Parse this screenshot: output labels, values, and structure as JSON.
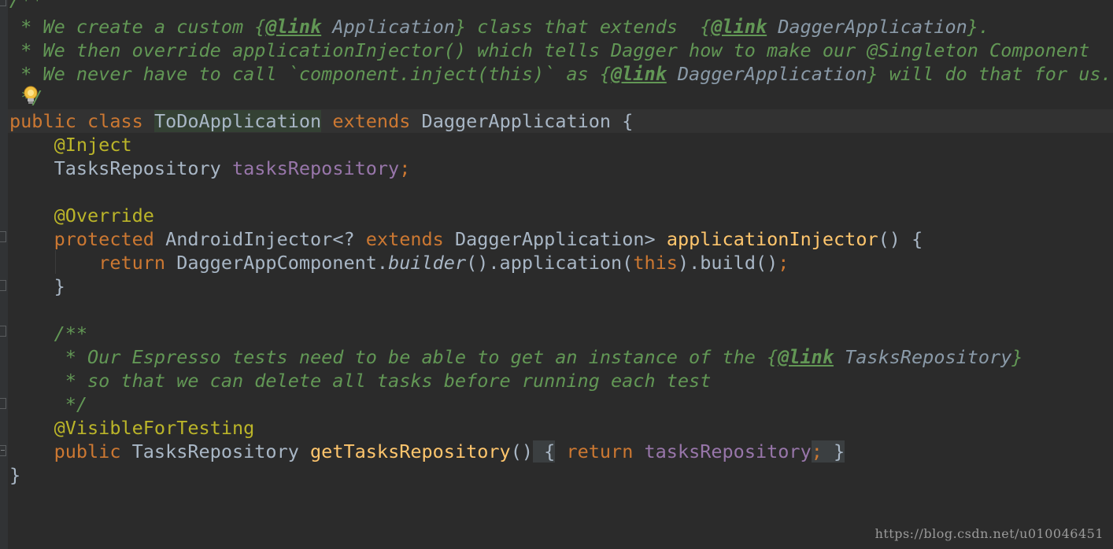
{
  "javadoc_top": {
    "open": "/**",
    "line1": {
      "star": " * We create a custom {",
      "tag1": "@link",
      "ref1": " Application",
      "mid": "} class that extends  {",
      "tag2": "@link",
      "ref2": " DaggerApplication",
      "end": "}."
    },
    "line2": " * We then override applicationInjector() which tells Dagger how to make our @Singleton Component",
    "line3": {
      "start": " * We never have to call `component.inject(this)` as {",
      "tag": "@link",
      "ref": " DaggerApplication",
      "end": "} will do that for us."
    },
    "close": " */"
  },
  "class_decl": {
    "kw_public": "public",
    "kw_class": "class",
    "name": "ToDoApplication",
    "kw_extends": "extends",
    "parent": "DaggerApplication",
    "brace": " {"
  },
  "field": {
    "annotation": "@Inject",
    "type": "TasksRepository",
    "name": "tasksRepository",
    "semi": ";"
  },
  "method1": {
    "annotation": "@Override",
    "kw_protected": "protected",
    "ret_type": "AndroidInjector<?",
    "kw_extends": "extends",
    "ret_type2": "DaggerApplication>",
    "name": "applicationInjector",
    "params": "() {",
    "kw_return": "return",
    "expr1": "DaggerAppComponent.",
    "builder": "builder",
    "expr2": "().application(",
    "kw_this": "this",
    "expr3": ").build()",
    "semi": ";",
    "close": "}"
  },
  "javadoc_inner": {
    "open": "/**",
    "line1": {
      "start": " * Our Espresso tests need to be able to get an instance of the {",
      "tag": "@link",
      "ref": " TasksRepository",
      "end": "}"
    },
    "line2": " * so that we can delete all tasks before running each test",
    "close": " */"
  },
  "method2": {
    "annotation": "@VisibleForTesting",
    "kw_public": "public",
    "type": "TasksRepository",
    "name": "getTasksRepository",
    "params": "()",
    "open": " {",
    "kw_return": "return",
    "field": "tasksRepository",
    "semi": ";",
    "close": " }"
  },
  "class_close": "}",
  "watermark": "https://blog.csdn.net/u010046451",
  "colors": {
    "background": "#2b2b2b",
    "keyword": "#cc7832",
    "annotation": "#bbb529",
    "field": "#9876aa",
    "method": "#ffc66d",
    "javadoc": "#629755",
    "text": "#a9b7c6"
  },
  "icons": {
    "gutter_intention": "lightbulb-icon"
  }
}
